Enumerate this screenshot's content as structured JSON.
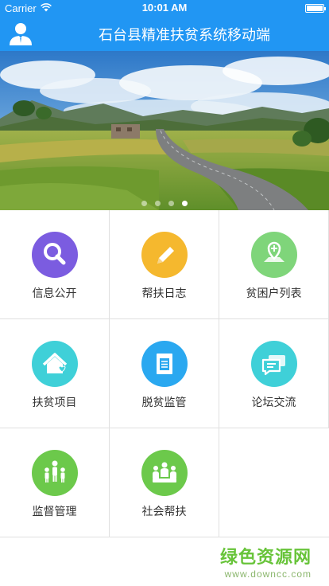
{
  "status_bar": {
    "carrier": "Carrier",
    "time": "10:01 AM",
    "battery_level": 1.0
  },
  "header": {
    "title": "石台县精准扶贫系统移动端",
    "avatar_icon": "user-avatar-icon"
  },
  "banner": {
    "slide_count": 4,
    "active_slide": 4
  },
  "menu": {
    "items": [
      {
        "label": "信息公开",
        "icon": "search-icon",
        "color": "#7B5CE0"
      },
      {
        "label": "帮扶日志",
        "icon": "pencil-icon",
        "color": "#F5B82E"
      },
      {
        "label": "贫困户列表",
        "icon": "map-pin-icon",
        "color": "#7FD57A"
      },
      {
        "label": "扶贫项目",
        "icon": "house-heart-icon",
        "color": "#3FD0D8"
      },
      {
        "label": "脱贫监管",
        "icon": "clipboard-icon",
        "color": "#2AA8F0"
      },
      {
        "label": "论坛交流",
        "icon": "chat-bubbles-icon",
        "color": "#3FD0D8"
      },
      {
        "label": "监督管理",
        "icon": "people-group-icon",
        "color": "#6CC94B"
      },
      {
        "label": "社会帮扶",
        "icon": "team-icon",
        "color": "#6CC94B"
      }
    ]
  },
  "watermark": {
    "text": "绿色资源网",
    "url": "www.downcc.com"
  }
}
